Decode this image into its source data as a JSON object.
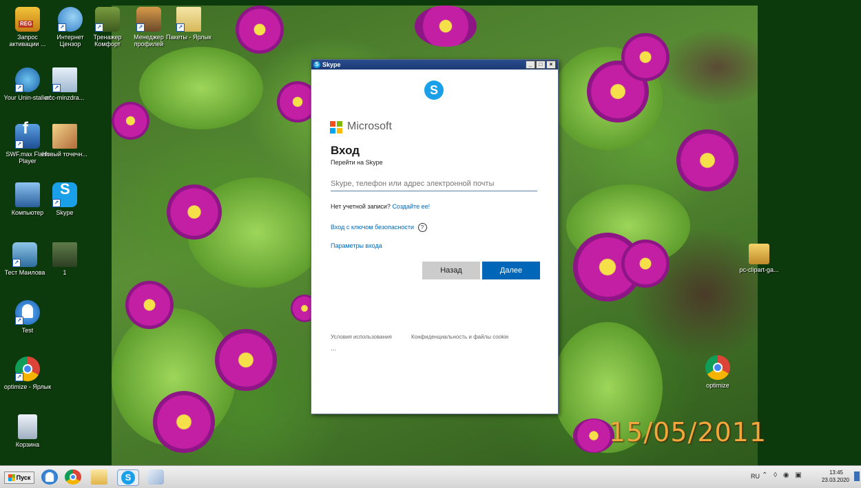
{
  "desktop": {
    "icons": [
      {
        "label": "Запрос активации ...",
        "icon": "reg-icon"
      },
      {
        "label": "Интернет Цензор",
        "icon": "internet-censor-icon"
      },
      {
        "label": "Тренажер Комфорт",
        "icon": "trainer-icon"
      },
      {
        "label": "Менеджер профилей",
        "icon": "profile-manager-icon"
      },
      {
        "label": "Пакеты - Ярлык",
        "icon": "packages-icon"
      },
      {
        "label": "Your Unin-staller!",
        "icon": "uninstaller-icon"
      },
      {
        "label": "acc-minzdra...",
        "icon": "image-file-icon"
      },
      {
        "label": "SWF.max Flash Player",
        "icon": "flash-player-icon"
      },
      {
        "label": "Новый точечн...",
        "icon": "bitmap-icon"
      },
      {
        "label": "Компьютер",
        "icon": "computer-icon"
      },
      {
        "label": "Skype",
        "icon": "skype-icon"
      },
      {
        "label": "Тест Маилова",
        "icon": "test-program-icon"
      },
      {
        "label": "1",
        "icon": "movie-file-icon"
      },
      {
        "label": "Test",
        "icon": "ghost-icon"
      },
      {
        "label": "optimize - Ярлык",
        "icon": "chrome-icon"
      },
      {
        "label": "Корзина",
        "icon": "recycle-bin-icon"
      },
      {
        "label": "pc-clipart-ga...",
        "icon": "clipart-icon"
      },
      {
        "label": "optimize",
        "icon": "chrome-icon"
      }
    ],
    "wallpaper_date": "15/05/2011"
  },
  "skype_window": {
    "title": "Skype",
    "titlebar_buttons": [
      "_",
      "□",
      "×"
    ],
    "brand": "Microsoft",
    "heading": "Вход",
    "subheading": "Перейти на Skype",
    "input_placeholder": "Skype, телефон или адрес электронной почты",
    "no_account_text": "Нет учетной записи?",
    "create_link": "Создайте ее!",
    "security_key_link": "Вход с ключом безопасности",
    "help_symbol": "?",
    "signin_options_link": "Параметры входа",
    "back_label": "Назад",
    "next_label": "Далее",
    "terms_link": "Условия использования",
    "privacy_link": "Конфиденциальность и файлы cookie",
    "more_options": "...",
    "colors": {
      "accent": "#0067b8",
      "skype_blue": "#1aa0e8"
    }
  },
  "taskbar": {
    "start_label": "Пуск",
    "pinned": [
      "ghost-icon",
      "chrome-icon",
      "folder-icon",
      "skype-icon",
      "paint-icon"
    ],
    "language": "RU",
    "tray_icons": "⌃ ◊ ◉ ▣",
    "clock_time": "13:45",
    "clock_date": "23.03.2020"
  }
}
